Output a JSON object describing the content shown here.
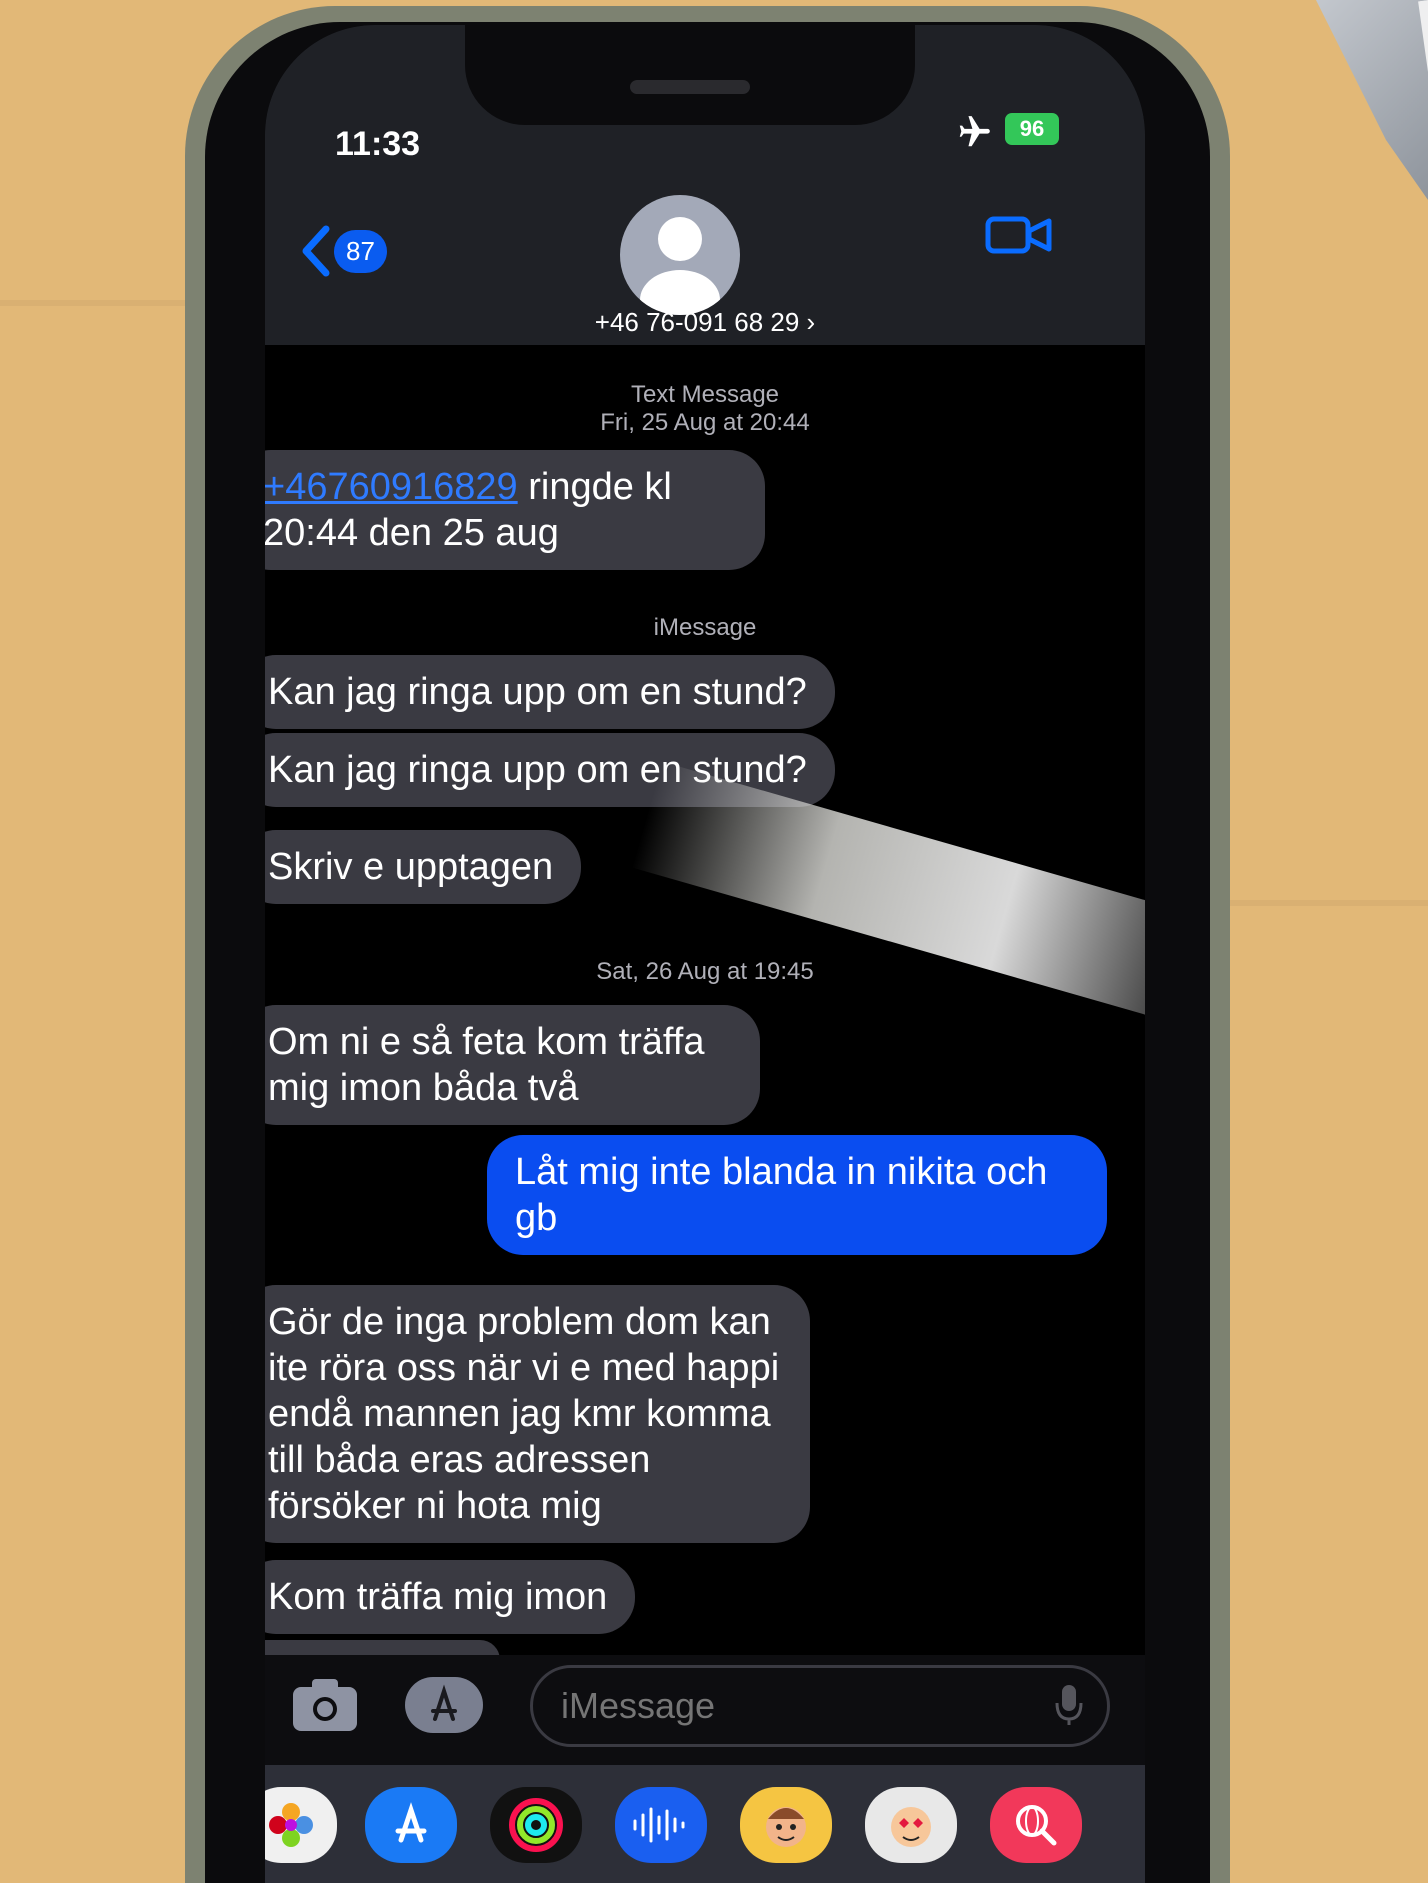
{
  "status_bar": {
    "time": "11:33",
    "battery": "96"
  },
  "header": {
    "back_count": "87",
    "contact": "+46 76-091 68 29 ›"
  },
  "thread": {
    "ts1_type": "Text Message",
    "ts1_date": "Fri, 25 Aug at 20:44",
    "m1_link": "+46760916829",
    "m1_text": " ringde kl 20:44 den 25 aug",
    "ts2": "iMessage",
    "m2": "Kan jag ringa upp om en stund?",
    "m3": "Kan jag ringa upp om en stund?",
    "m4": "Skriv e upptagen",
    "ts3": "Sat, 26 Aug at 19:45",
    "m5": "Om ni e så feta kom träffa mig imon båda två",
    "m6": "Låt mig inte blanda in nikita och gb",
    "m7": "Gör de inga problem dom kan ite röra oss när vi e med happi endå mannen jag kmr komma till båda eras adressen försöker ni hota mig",
    "m8": "Kom träffa mig imon"
  },
  "composer": {
    "placeholder": "iMessage"
  },
  "app_drawer": [
    "photos-app",
    "app-store",
    "activity",
    "audio-message",
    "memoji",
    "memoji-stickers",
    "web-search"
  ]
}
